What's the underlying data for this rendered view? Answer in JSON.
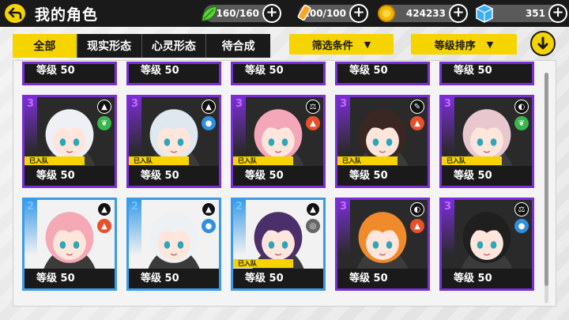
{
  "header": {
    "title": "我的角色",
    "stamina": "160/160",
    "energy": "100/100",
    "coins": "424233",
    "gems": "351"
  },
  "tabs": [
    "全部",
    "现实形态",
    "心灵形态",
    "待合成"
  ],
  "filters": {
    "filter_label": "筛选条件",
    "sort_label": "等级排序"
  },
  "colors": {
    "accent": "#f5d400",
    "rank3": "#7a2ed6",
    "rank2": "#3a9be8",
    "dark": "#1a1a1a"
  },
  "top_row_levels": [
    "等级 50",
    "等级 50",
    "等级 50",
    "等级 50",
    "等级 50"
  ],
  "cards": [
    {
      "rank": "3",
      "team": "已入队",
      "level": "等级 50",
      "type_icon": "sparkle-icon",
      "element_icon": "leaf-icon",
      "element_color": "#39b54a",
      "hair": "#eef0f5",
      "tier": "purple"
    },
    {
      "rank": "3",
      "team": "已入队",
      "level": "等级 50",
      "type_icon": "sparkle-icon",
      "element_icon": "water-drop-icon",
      "element_color": "#2f8fe0",
      "hair": "#dfe8ef",
      "tier": "purple"
    },
    {
      "rank": "3",
      "team": "已入队",
      "level": "等级 50",
      "type_icon": "scales-icon",
      "element_icon": "fire-icon",
      "element_color": "#e8502a",
      "hair": "#f3a7b8",
      "tier": "purple"
    },
    {
      "rank": "3",
      "team": "已入队",
      "level": "等级 50",
      "type_icon": "sword-icon",
      "element_icon": "fire-icon",
      "element_color": "#e8502a",
      "hair": "#3a2622",
      "tier": "purple"
    },
    {
      "rank": "3",
      "team": "已入队",
      "level": "等级 50",
      "type_icon": "shield-icon",
      "element_icon": "leaf-icon",
      "element_color": "#39b54a",
      "hair": "#e9c7cf",
      "tier": "purple"
    },
    {
      "rank": "2",
      "team": "",
      "level": "等级 50",
      "type_icon": "sparkle-icon",
      "element_icon": "fire-icon",
      "element_color": "#e8502a",
      "hair": "#f4a9b5",
      "tier": "blue"
    },
    {
      "rank": "2",
      "team": "",
      "level": "等级 50",
      "type_icon": "sparkle-icon",
      "element_icon": "water-drop-icon",
      "element_color": "#2f8fe0",
      "hair": "#eef1f4",
      "tier": "blue"
    },
    {
      "rank": "2",
      "team": "已入队",
      "level": "等级 50",
      "type_icon": "sparkle-icon",
      "element_icon": "wind-icon",
      "element_color": "#666666",
      "hair": "#4a2f6a",
      "tier": "blue"
    },
    {
      "rank": "3",
      "team": "",
      "level": "等级 50",
      "type_icon": "shield-icon",
      "element_icon": "fire-icon",
      "element_color": "#e8502a",
      "hair": "#f08a2a",
      "tier": "purple"
    },
    {
      "rank": "3",
      "team": "",
      "level": "等级 50",
      "type_icon": "scales-icon",
      "element_icon": "water-drop-icon",
      "element_color": "#2f8fe0",
      "hair": "#1f1f1f",
      "tier": "purple"
    }
  ]
}
